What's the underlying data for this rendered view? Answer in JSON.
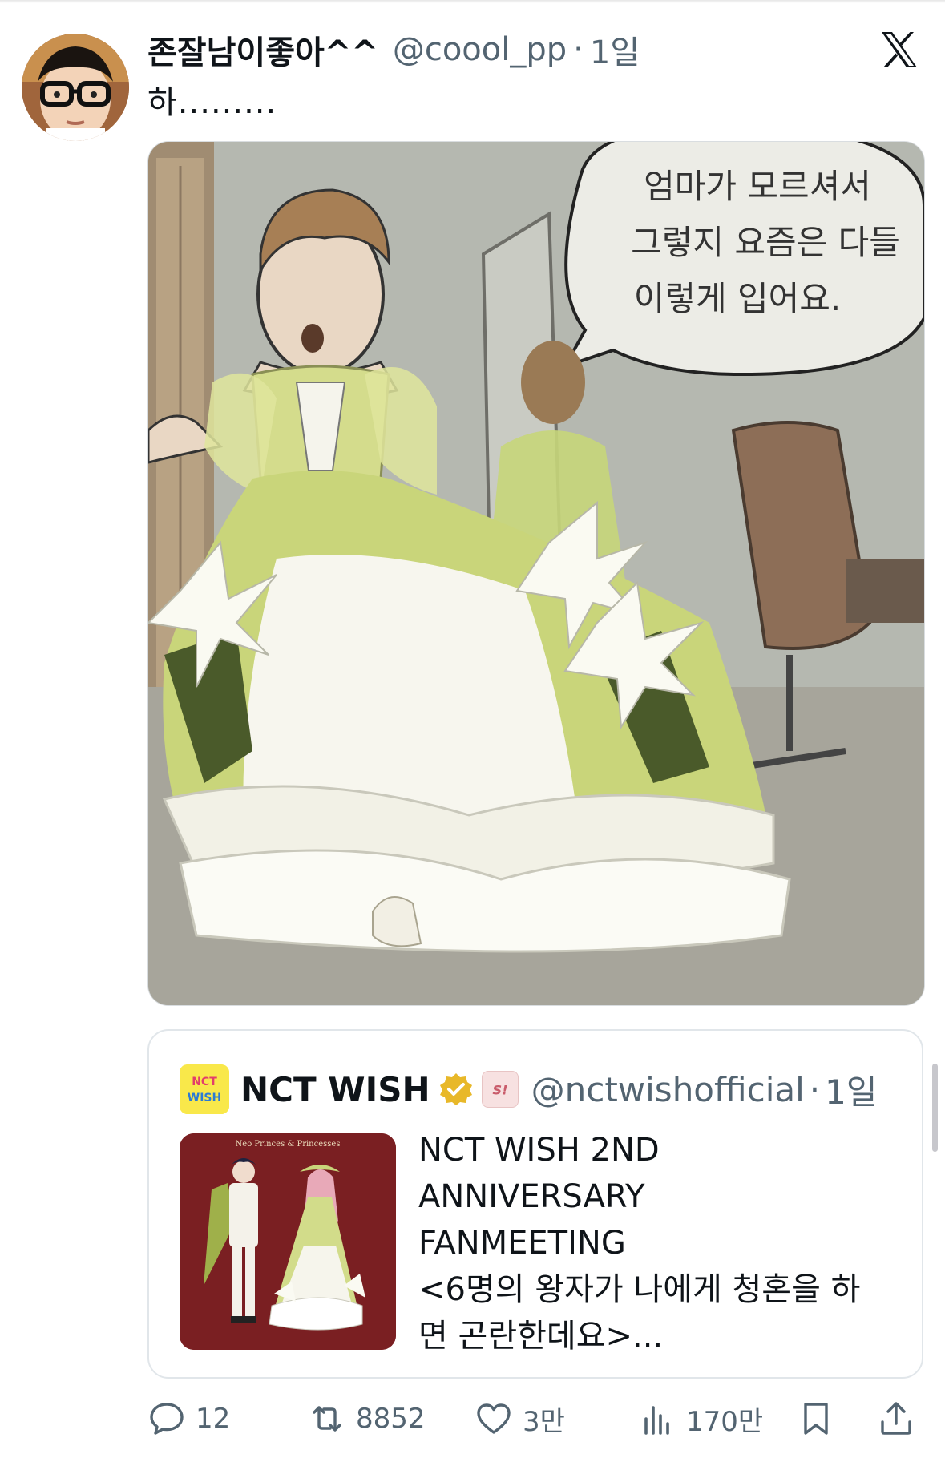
{
  "tweet": {
    "display_name": "존잘남이좋아^^",
    "handle": "@coool_pp",
    "separator": "·",
    "time": "1일",
    "text": "하.........",
    "media": {
      "speech_bubble_lines": [
        "엄마가 모르셔서",
        "그렇지 요즘은 다들",
        "이렇게 입어요."
      ]
    }
  },
  "quote": {
    "name": "NCT WISH",
    "handle": "@nctwishofficial",
    "separator": "·",
    "time": "1일",
    "avatar_text": "NCT WISH",
    "badge_text": "S!",
    "thumbnail_title": "Neo Princes & Princesses",
    "body_lines": [
      "NCT WISH 2ND",
      "ANNIVERSARY",
      "FANMEETING",
      "<6명의 왕자가 나에게 청혼을 하",
      "면 곤란한데요>..."
    ]
  },
  "actions": {
    "replies": "12",
    "reposts": "8852",
    "likes": "3만",
    "views": "170만"
  },
  "colors": {
    "text": "#0f1419",
    "muted": "#536471",
    "verified_gold": "#e8b829",
    "quote_thumb_bg": "#7a1f22",
    "dress_green": "#c9d57a"
  },
  "icons": [
    "x-logo-icon",
    "verified-badge-icon",
    "affiliate-badge-icon",
    "reply-icon",
    "repost-icon",
    "like-icon",
    "views-icon",
    "bookmark-icon",
    "share-icon"
  ]
}
